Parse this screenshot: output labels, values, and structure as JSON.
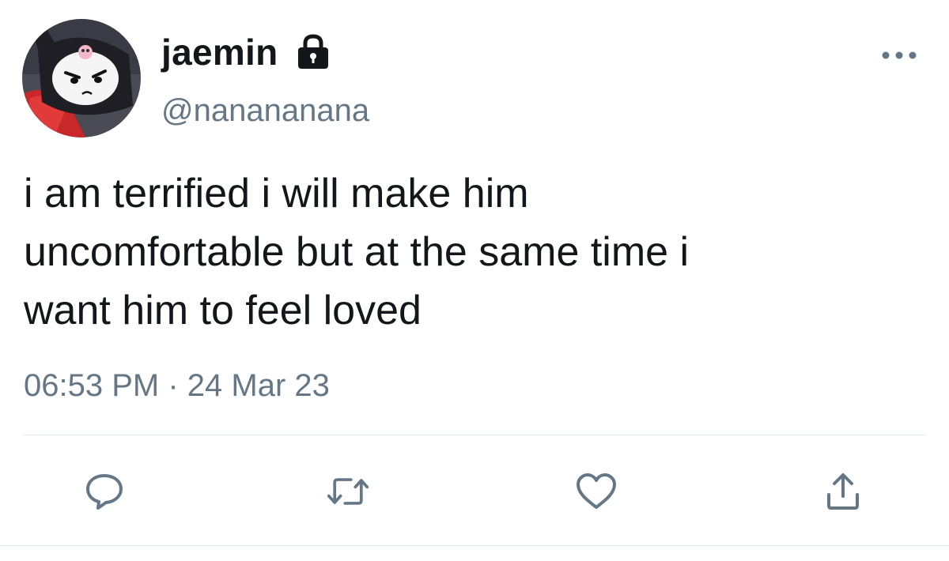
{
  "user": {
    "display_name": "jaemin",
    "handle": "@nanananana",
    "avatar_icon": "kuromi-avatar",
    "protected_icon": "lock-icon"
  },
  "tweet": {
    "text": "i am terrified i will make him\nuncomfortable but at the same time i\nwant him to feel loved",
    "time": "06:53 PM",
    "separator": "·",
    "date": "24 Mar 23"
  },
  "actions": [
    {
      "name": "reply",
      "icon": "reply-icon"
    },
    {
      "name": "retweet",
      "icon": "retweet-icon"
    },
    {
      "name": "like",
      "icon": "heart-icon"
    },
    {
      "name": "share",
      "icon": "share-icon"
    }
  ],
  "colors": {
    "text_primary": "#14171a",
    "text_secondary": "#657786",
    "icon": "#657786",
    "divider": "#e1e8ed"
  }
}
